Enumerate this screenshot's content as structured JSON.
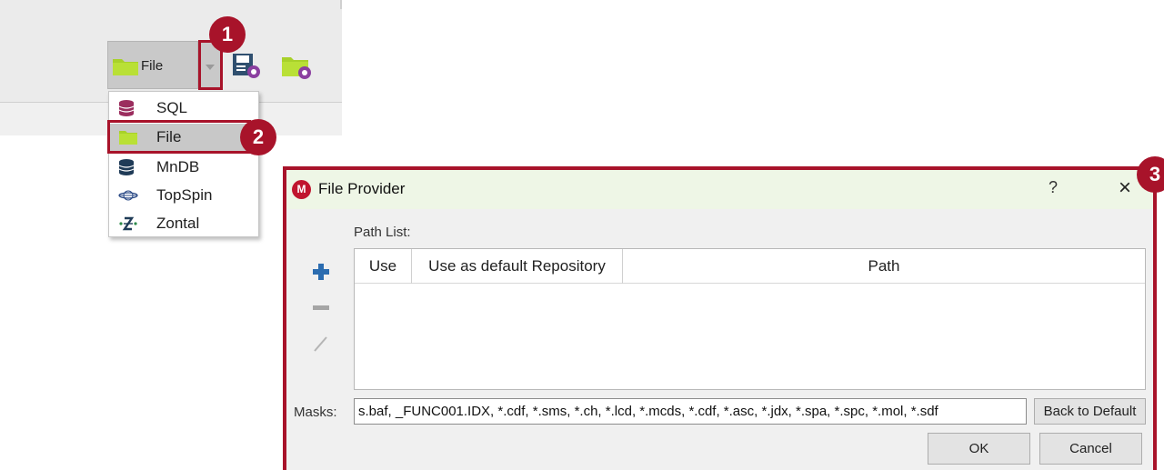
{
  "toolbar": {
    "file_button_label": "File",
    "icons": [
      "folder-icon",
      "chevron-down-icon",
      "save-settings-icon",
      "folder-settings-icon"
    ]
  },
  "menu": {
    "items": [
      {
        "label": "SQL",
        "icon": "database-icon"
      },
      {
        "label": "File",
        "icon": "folder-icon",
        "selected": true
      },
      {
        "label": "MnDB",
        "icon": "database-icon"
      },
      {
        "label": "TopSpin",
        "icon": "topspin-icon"
      },
      {
        "label": "Zontal",
        "icon": "zontal-icon"
      }
    ]
  },
  "callouts": [
    "1",
    "2",
    "3"
  ],
  "dialog": {
    "title": "File Provider",
    "help_label": "?",
    "close_label": "×",
    "path_list_label": "Path List:",
    "table": {
      "columns": [
        "Use",
        "Use as default Repository",
        "Path"
      ],
      "rows": []
    },
    "masks_label": "Masks:",
    "masks_value": "s.baf, _FUNC001.IDX, *.cdf, *.sms, *.ch, *.lcd, *.mcds, *.cdf, *.asc, *.jdx, *.spa, *.spc, *.mol, *.sdf",
    "back_to_default_label": "Back to Default",
    "ok_label": "OK",
    "cancel_label": "Cancel"
  },
  "colors": {
    "callout": "#a8132a",
    "folder": "#a8d12a",
    "titlebar": "#eef6e6",
    "add_icon": "#2b6cb0"
  }
}
